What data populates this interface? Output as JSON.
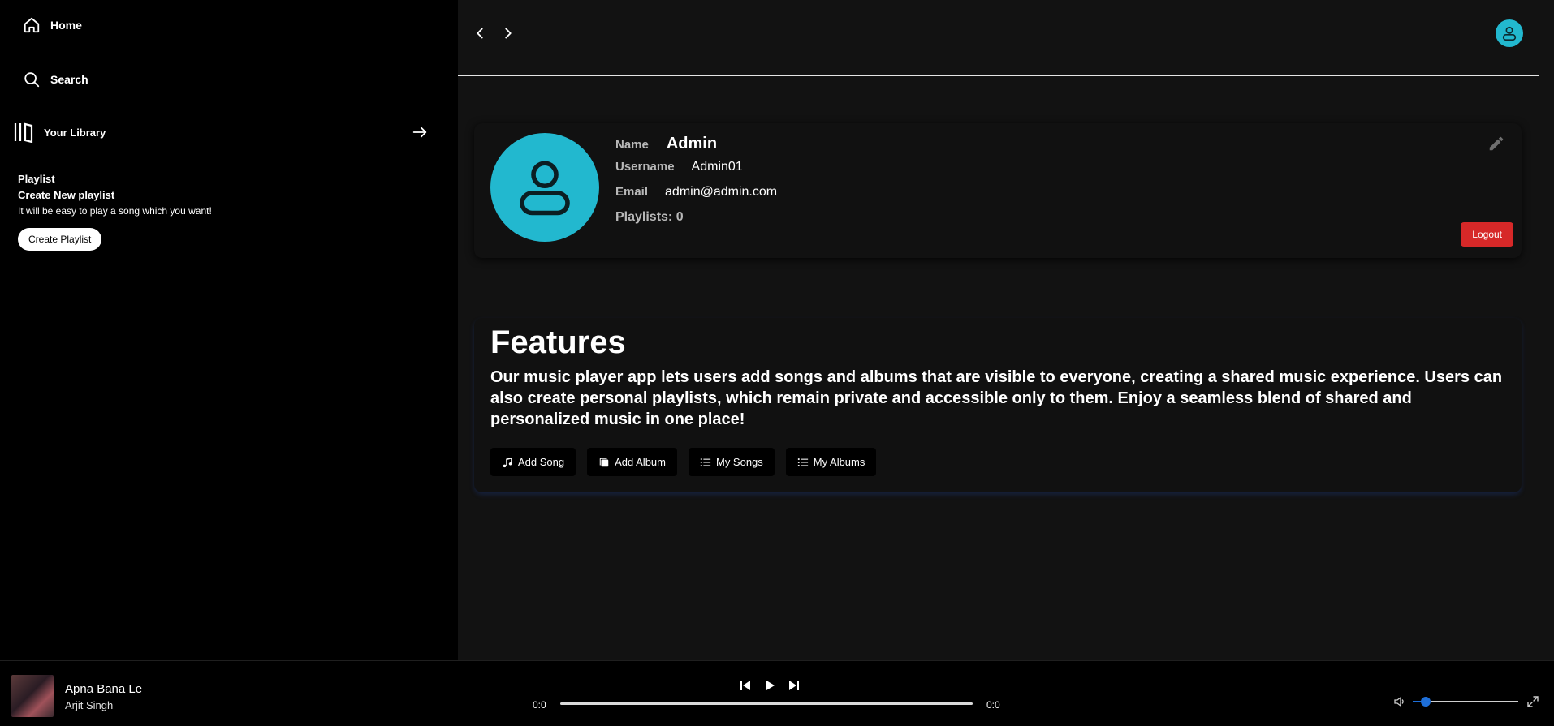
{
  "sidebar": {
    "home_label": "Home",
    "search_label": "Search",
    "library_label": "Your Library",
    "playlist": {
      "title": "Playlist",
      "create_new": "Create New playlist",
      "description": "It will be easy to play a song which you want!",
      "button_label": "Create Playlist"
    }
  },
  "profile": {
    "name_label": "Name",
    "name": "Admin",
    "username_label": "Username",
    "username": "Admin01",
    "email_label": "Email",
    "email": "admin@admin.com",
    "playlists_text": "Playlists: 0",
    "logout_label": "Logout",
    "avatar_color": "#22b8cf"
  },
  "features": {
    "title": "Features",
    "description": "Our music player app lets users add songs and albums that are visible to everyone, creating a shared music experience. Users can also create personal playlists, which remain private and accessible only to them. Enjoy a seamless blend of shared and personalized music in one place!",
    "buttons": [
      {
        "label": "Add Song",
        "icon": "music-note-icon"
      },
      {
        "label": "Add Album",
        "icon": "album-icon"
      },
      {
        "label": "My Songs",
        "icon": "list-icon"
      },
      {
        "label": "My Albums",
        "icon": "list-icon"
      }
    ]
  },
  "player": {
    "title": "Apna Bana Le",
    "artist": "Arjit Singh",
    "current_time": "0:0",
    "total_time": "0:0",
    "progress": 0,
    "volume": 0.12,
    "accent_color": "#1e6fd9"
  },
  "colors": {
    "logout": "#d62828",
    "background": "#121212"
  }
}
